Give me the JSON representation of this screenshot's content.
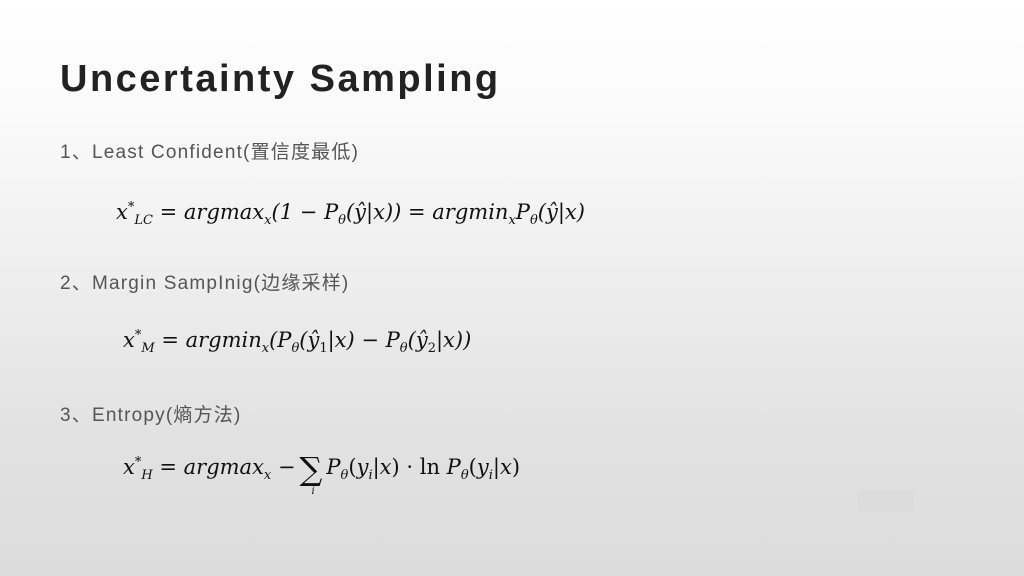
{
  "slide": {
    "title": "Uncertainty Sampling",
    "items": [
      {
        "label": "1、Least Confident(置信度最低)",
        "formula": "x*_LC = argmax_x (1 − Pθ(ŷ|x)) = argmin_x Pθ(ŷ|x)",
        "parts": {
          "lhs": "x",
          "sub": "LC",
          "p1": " = argmax",
          "s1": "x",
          "p2": "(1 − P",
          "th": "θ",
          "p3": "(ŷ|x)) = argmin",
          "s2": "x",
          "p4": "P",
          "p5": "(ŷ|x)"
        }
      },
      {
        "label": "2、Margin SampInig(边缘采样)",
        "formula": "x*_M = argmin_x (Pθ(ŷ1|x) − Pθ(ŷ2|x))",
        "parts": {
          "lhs": "x",
          "sub": "M",
          "p1": " = argmin",
          "s1": "x",
          "p2": "(P",
          "th": "θ",
          "p3": "(ŷ",
          "n1": "1",
          "p4": "|x) − P",
          "p5": "(ŷ",
          "n2": "2",
          "p6": "|x))"
        }
      },
      {
        "label": "3、Entropy(熵方法)",
        "formula": "x*_H = argmax_x − Σ_i Pθ(y_i|x) · ln Pθ(y_i|x)",
        "parts": {
          "lhs": "x",
          "sub": "H",
          "p1": " = argmax",
          "s1": "x",
          "p2": " −",
          "sum": "∑",
          "idx": "i",
          "p3": "P",
          "th": "θ",
          "p4": "(y",
          "i": "i",
          "p5": "|x) · ln P",
          "p6": "(y",
          "p7": "|x)"
        }
      }
    ],
    "star": "*"
  }
}
